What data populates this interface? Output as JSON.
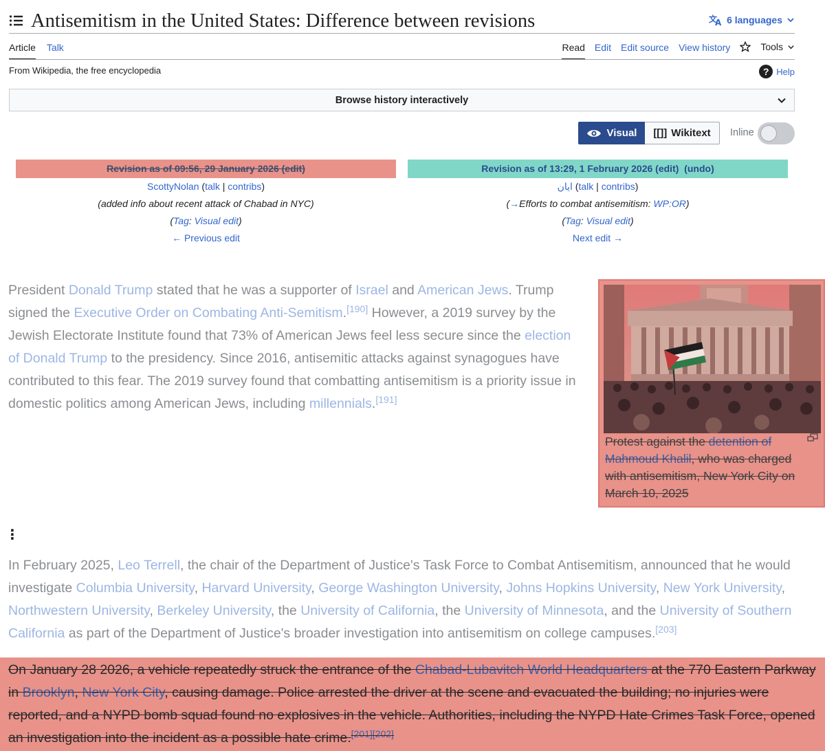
{
  "header": {
    "title": "Antisemitism in the United States: Difference between revisions",
    "languages_label": "6 languages"
  },
  "tabs_left": [
    {
      "label": "Article",
      "selected": true
    },
    {
      "label": "Talk",
      "selected": false
    }
  ],
  "tabs_right": [
    {
      "label": "Read",
      "selected": true
    },
    {
      "label": "Edit",
      "selected": false
    },
    {
      "label": "Edit source",
      "selected": false
    },
    {
      "label": "View history",
      "selected": false
    }
  ],
  "tools_label": "Tools",
  "tagline": "From Wikipedia, the free encyclopedia",
  "help_label": "Help",
  "browse_history_label": "Browse history interactively",
  "diff_toggle": {
    "visual_label": "Visual",
    "wikitext_label": "Wikitext",
    "wikitext_glyph": "[[]]",
    "inline_label": "Inline",
    "inline_on": false
  },
  "old_revision": {
    "heading": "Revision as of 09:56, 29 January 2026",
    "edit_link": "edit",
    "user": "ScottyNolan",
    "talk": "talk",
    "contribs": "contribs",
    "summary": "(added info about recent attack of Chabad in NYC)",
    "tag_prefix": "Tag",
    "tag": "Visual edit",
    "nav": "← Previous edit"
  },
  "new_revision": {
    "heading": "Revision as of 13:29, 1 February 2026",
    "edit_link": "edit",
    "undo_link": "undo",
    "user": "ایان",
    "talk": "talk",
    "contribs": "contribs",
    "summary_arrow": "→",
    "summary_section": "Efforts to combat antisemitism",
    "summary_link": "WP:OR",
    "tag_prefix": "Tag",
    "tag": "Visual edit",
    "nav": "Next edit →"
  },
  "paragraph1": {
    "t1": "President ",
    "l1": "Donald Trump",
    "t2": " stated that he was a supporter of ",
    "l2": "Israel",
    "t3": " and ",
    "l3": "American Jews",
    "t4": ". Trump signed the ",
    "l4": "Executive Order on Combating Anti-Semitism",
    "t5": ".",
    "r1": "[190]",
    "t6": " However, a 2019 survey by the Jewish Electorate Institute found that 73% of American Jews feel less secure since the ",
    "l5": "election of Donald Trump",
    "t7": " to the presidency. Since 2016, antisemitic attacks against synagogues have contributed to this fear. The 2019 survey found that combatting antisemitism is a priority issue in domestic politics among American Jews, including ",
    "l6": "millennials",
    "t8": ".",
    "r2": "[191]"
  },
  "thumbnail": {
    "caption_t1": "Protest against the ",
    "caption_l1": "detention of Mahmoud Khalil",
    "caption_t2": ", who was charged with antisemitism, New York City on March 10, 2025"
  },
  "ellipsis": "⋮",
  "paragraph2": {
    "t1": "In February 2025, ",
    "l1": "Leo Terrell",
    "t2": ", the chair of the Department of Justice's Task Force to Combat Antisemitism, announced that he would investigate ",
    "l2": "Columbia University",
    "s1": ", ",
    "l3": "Harvard University",
    "s2": ", ",
    "l4": "George Washington University",
    "s3": ", ",
    "l5": "Johns Hopkins University",
    "s4": ", ",
    "l6": "New York University",
    "s5": ", ",
    "l7": "Northwestern University",
    "s6": ", ",
    "l8": "Berkeley University",
    "t3": ", the ",
    "l9": "University of California",
    "t4": ", the ",
    "l10": "University of Minnesota",
    "t5": ", and the ",
    "l11": "University of Southern California",
    "t6": " as part of the Department of Justice's broader investigation into antisemitism on college campuses.",
    "r1": "[203]"
  },
  "paragraph3": {
    "t1": "On January 28 2026, a vehicle repeatedly struck the entrance of the ",
    "l1": "Chabad-Lubavitch World Headquarters",
    "t2": " at the 770 Eastern Parkway in ",
    "l2": "Brooklyn",
    "s1": ", ",
    "l3": "New York City",
    "t3": ", causing damage. Police arrested the driver at the scene and evacuated the building; no injuries were reported, and a NYPD bomb squad found no explosives in the vehicle. Authorities, including the NYPD Hate Crimes Task Force, opened an investigation into the incident as a possible hate crime.",
    "r1": "[201]",
    "r2": "[202]"
  },
  "colors": {
    "deleted_bg": "#e8928a",
    "added_bg": "#80d7c8",
    "link": "#3366cc",
    "visual_button": "#2a4b8d"
  },
  "icons": [
    "menu-icon",
    "translate-icon",
    "chevron-down-icon",
    "star-icon",
    "help-icon",
    "eye-icon",
    "enlarge-icon"
  ]
}
